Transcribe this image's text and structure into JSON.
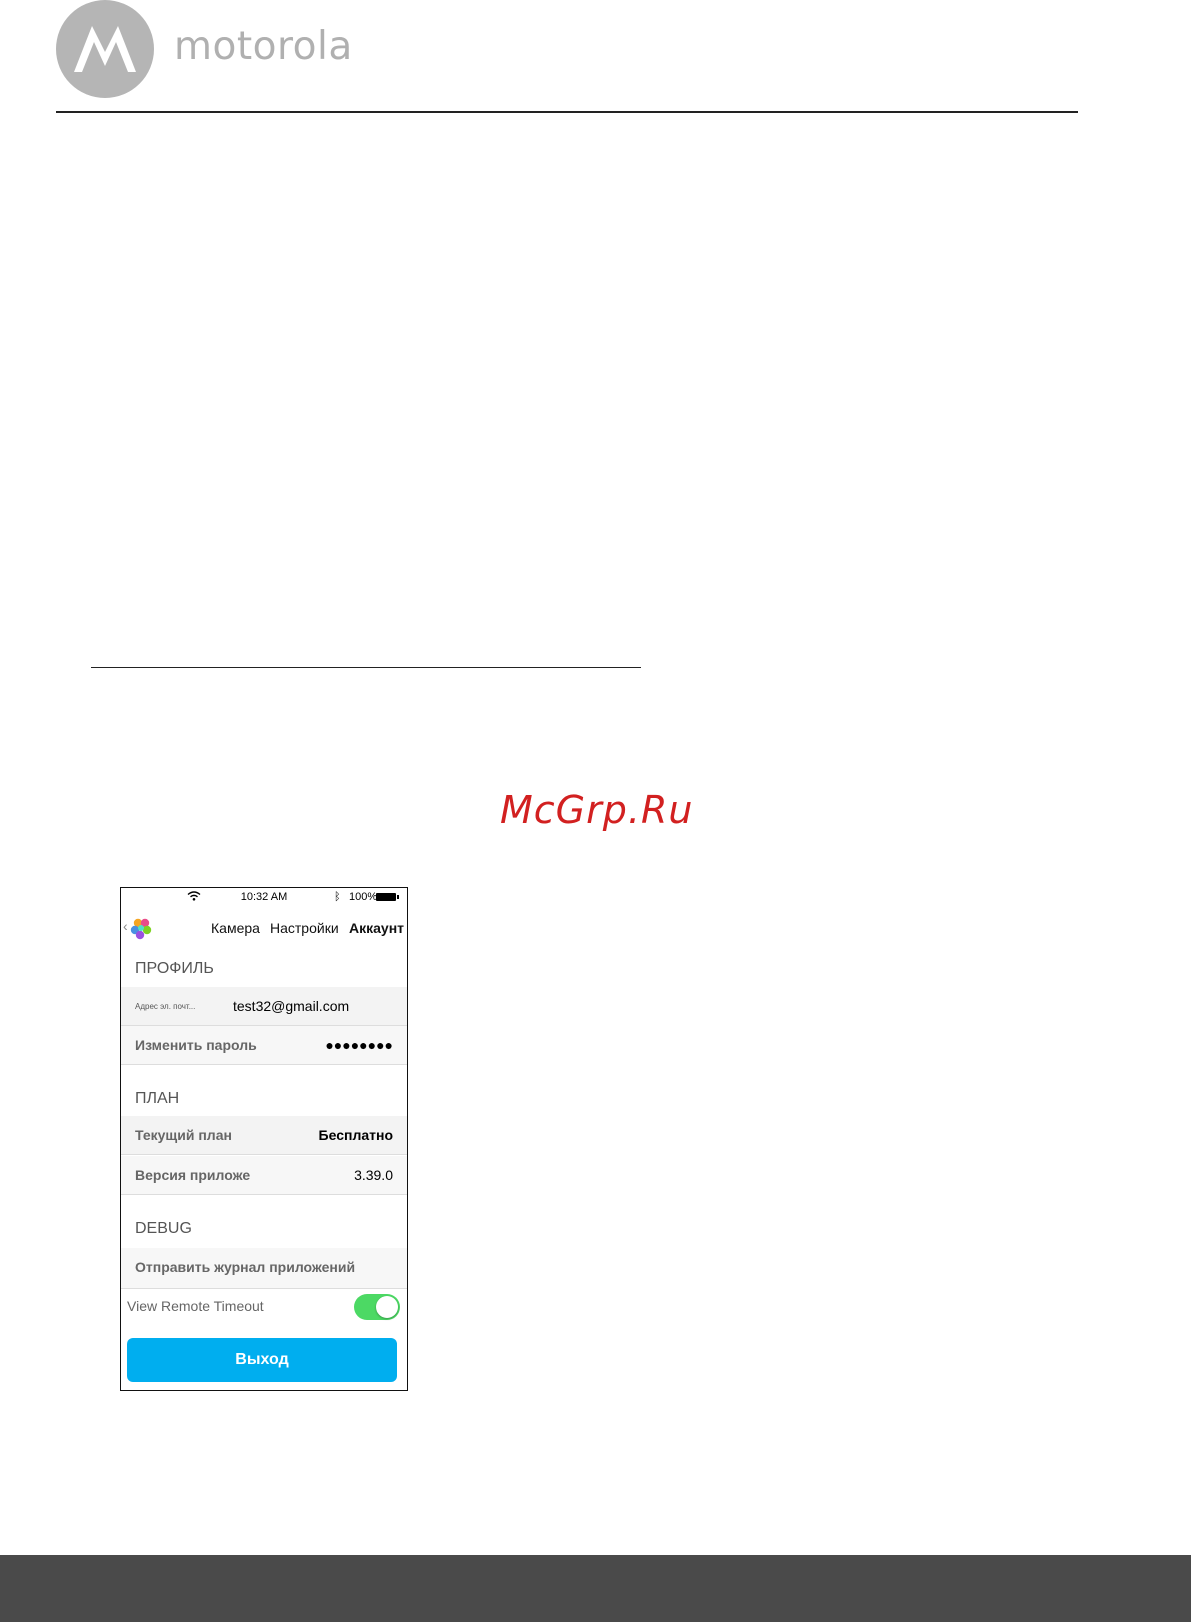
{
  "header": {
    "brand": "motorola",
    "logo_icon": "motorola-batwing-logo"
  },
  "watermark": "McGrp.Ru",
  "phone": {
    "status": {
      "time": "10:32 AM",
      "battery": "100%",
      "icons": [
        "wifi-icon",
        "bluetooth-icon",
        "battery-icon"
      ]
    },
    "nav": {
      "tab_camera": "Камера",
      "tab_settings": "Настройки",
      "tab_account": "Аккаунт"
    },
    "profile": {
      "title": "ПРОФИЛЬ",
      "email_label": "Адрес эл. почт...",
      "email_value": "test32@gmail.com",
      "password_label": "Изменить пароль",
      "password_value": "●●●●●●●●"
    },
    "plan": {
      "title": "ПЛАН",
      "current_label": "Текущий план",
      "current_value": "Бесплатно",
      "version_label": "Версия приложе",
      "version_value": "3.39.0"
    },
    "debug": {
      "title": "DEBUG",
      "send_log": "Отправить журнал приложений",
      "remote_timeout_label": "View Remote Timeout",
      "remote_timeout_on": true
    },
    "logout": "Выход",
    "colors": {
      "toggle_on": "#4cd964",
      "logout_button": "#00aeef"
    }
  },
  "footer_color": "#4a4a4a"
}
